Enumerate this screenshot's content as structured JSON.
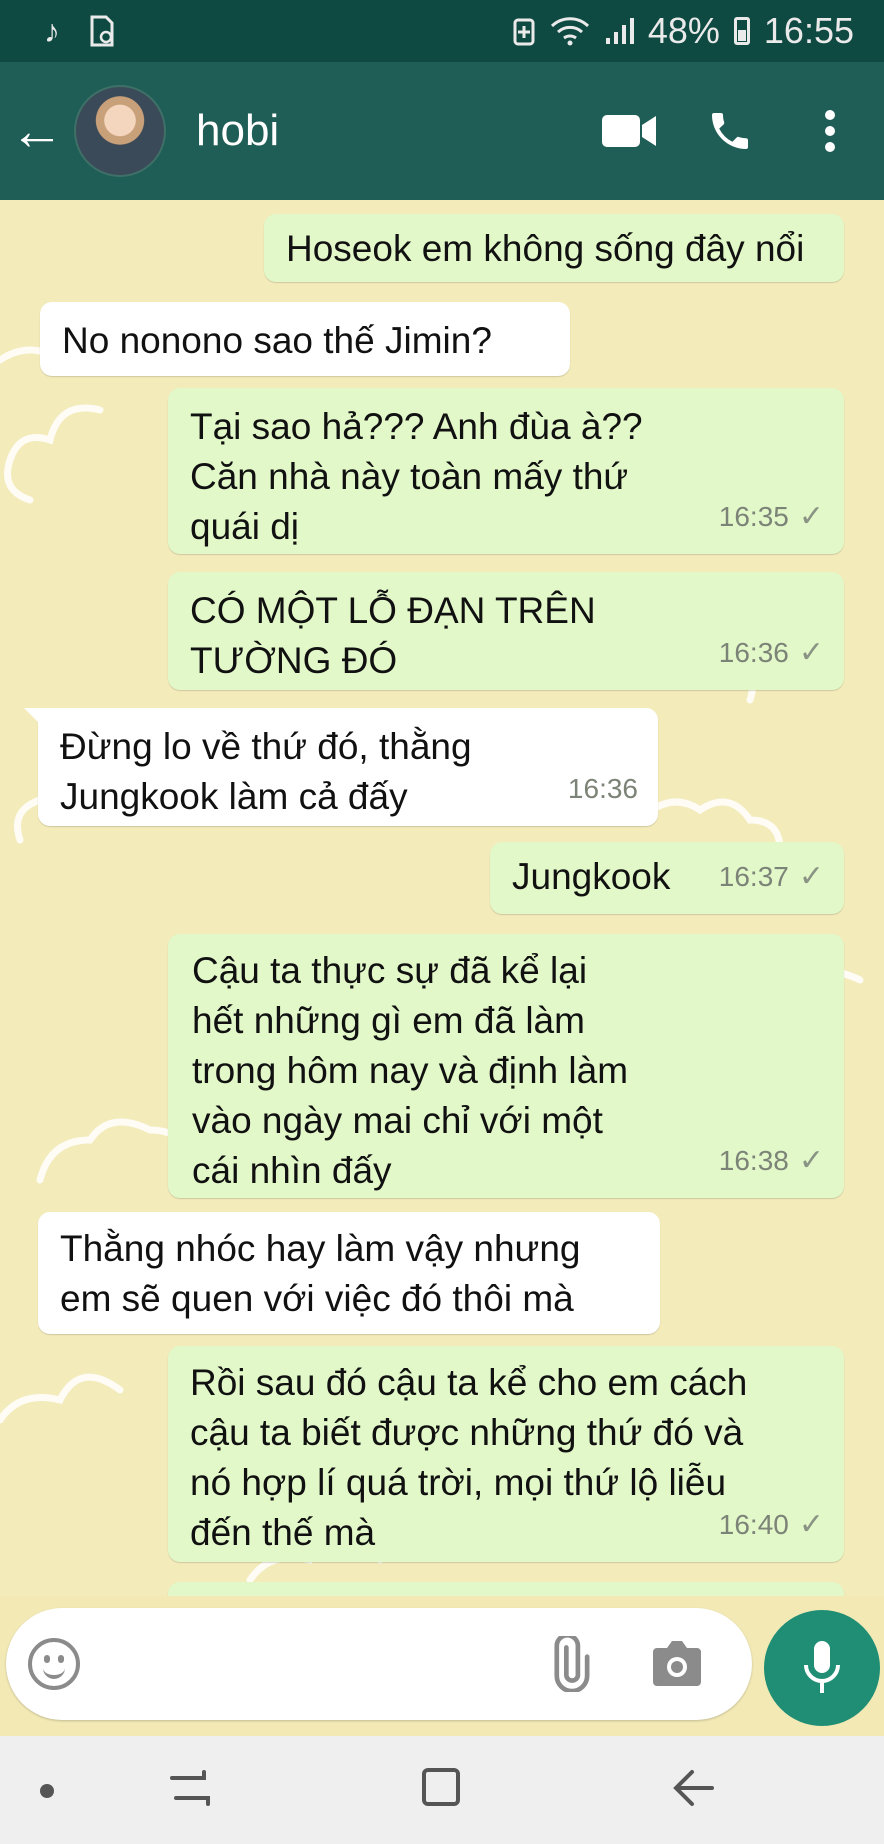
{
  "status_bar": {
    "left_icons": [
      "music-note-icon",
      "sim-card-icon"
    ],
    "right_icons": [
      "data-saver-icon",
      "wifi-icon",
      "signal-icon"
    ],
    "battery": "48%",
    "time": "16:55"
  },
  "header": {
    "contact_name": "hobi",
    "icons": [
      "back-arrow-icon",
      "avatar",
      "video-call-icon",
      "phone-call-icon",
      "more-vert-icon"
    ]
  },
  "messages": [
    {
      "dir": "out",
      "text": "Hoseok em không sống đây nổi",
      "time": "",
      "read": false
    },
    {
      "dir": "in",
      "text": "No nonono sao thế Jimin?",
      "time": ""
    },
    {
      "dir": "out",
      "text": "Tại sao hả??? Anh đùa à??\nCăn nhà này toàn mấy thứ\nquái dị",
      "time": "16:35",
      "read": true
    },
    {
      "dir": "out",
      "text": "CÓ MỘT LỖ ĐẠN TRÊN\nTƯỜNG ĐÓ",
      "time": "16:36",
      "read": true
    },
    {
      "dir": "in",
      "text": "Đừng lo về thứ đó, thằng\nJungkook làm cả đấy",
      "time": "16:36"
    },
    {
      "dir": "out",
      "text": "Jungkook",
      "time": "16:37",
      "read": true
    },
    {
      "dir": "out",
      "text": "Cậu ta thực sự đã kể lại\nhết những gì em đã làm\ntrong hôm nay và định làm\nvào ngày mai chỉ với một\ncái nhìn đấy",
      "time": "16:38",
      "read": true
    },
    {
      "dir": "in",
      "text": "Thằng nhóc hay làm vậy nhưng\nem sẽ quen với việc đó thôi mà",
      "time": ""
    },
    {
      "dir": "out",
      "text": "Rồi sau đó cậu ta kể cho em cách\ncậu ta biết được những thứ đó và\nnó hợp lí quá trời, mọi thứ lộ liễu\nđến thế mà",
      "time": "16:40",
      "read": true
    }
  ],
  "input": {
    "placeholder": ""
  },
  "colors": {
    "status_bar": "#0f4a42",
    "header": "#1f5e56",
    "outgoing": "#e2f8c9",
    "incoming": "#ffffff",
    "wallpaper": "#f3ebba",
    "mic_button": "#1f8e75"
  }
}
